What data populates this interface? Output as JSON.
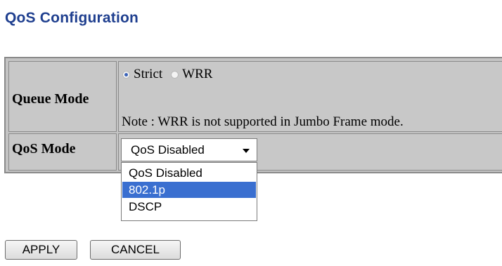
{
  "page": {
    "title": "QoS Configuration"
  },
  "queue_mode": {
    "label": "Queue Mode",
    "options": [
      {
        "label": "Strict",
        "checked": true
      },
      {
        "label": "WRR",
        "checked": false
      }
    ],
    "note": "Note : WRR is not supported in Jumbo Frame mode."
  },
  "qos_mode": {
    "label": "QoS Mode",
    "selected": "QoS Disabled",
    "dropdown_options": [
      "QoS Disabled",
      "802.1p",
      "DSCP"
    ],
    "highlighted_option": "802.1p"
  },
  "buttons": {
    "apply": "APPLY",
    "cancel": "CANCEL"
  },
  "colors": {
    "title": "#1f3f8f",
    "table_bg": "#c8c8c8",
    "highlight": "#3a6fd0"
  }
}
